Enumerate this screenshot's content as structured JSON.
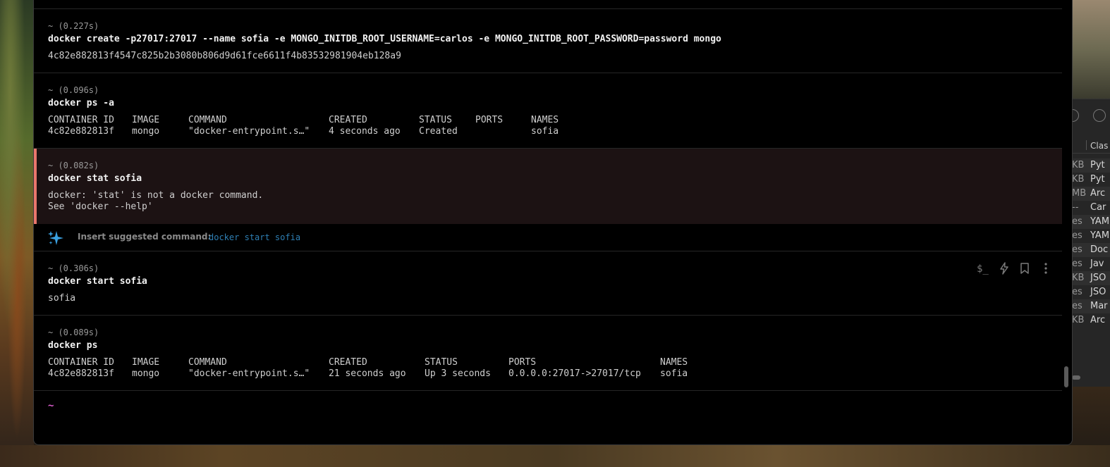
{
  "terminal": {
    "blocks": [
      {
        "id": "b1",
        "meta": "~ (0.227s)",
        "command": "docker create -p27017:27017 --name sofia -e MONGO_INITDB_ROOT_USERNAME=carlos -e MONGO_INITDB_ROOT_PASSWORD=password mongo",
        "output": "4c82e882813f4547c825b2b3080b806d9d61fce6611f4b83532981904eb128a9"
      },
      {
        "id": "b2",
        "meta": "~ (0.096s)",
        "command": "docker ps -a",
        "table": {
          "headers": [
            "CONTAINER ID",
            "IMAGE",
            "COMMAND",
            "CREATED",
            "STATUS",
            "PORTS",
            "NAMES"
          ],
          "row": [
            "4c82e882813f",
            "mongo",
            "\"docker-entrypoint.s…\"",
            "4 seconds ago",
            "Created",
            "",
            "sofia"
          ]
        }
      },
      {
        "id": "b3",
        "meta": "~ (0.082s)",
        "command": "docker stat sofia",
        "output_lines": [
          "docker: 'stat' is not a docker command.",
          "See 'docker --help'"
        ],
        "status": "error"
      },
      {
        "id": "b4",
        "meta": "~ (0.306s)",
        "command": "docker start sofia",
        "output": "sofia"
      },
      {
        "id": "b5",
        "meta": "~ (0.089s)",
        "command": "docker ps",
        "table": {
          "headers": [
            "CONTAINER ID",
            "IMAGE",
            "COMMAND",
            "CREATED",
            "STATUS",
            "PORTS",
            "NAMES"
          ],
          "row": [
            "4c82e882813f",
            "mongo",
            "\"docker-entrypoint.s…\"",
            "21 seconds ago",
            "Up 3 seconds",
            "0.0.0.0:27017->27017/tcp",
            "sofia"
          ]
        }
      }
    ],
    "suggestion": {
      "label": "Insert suggested command:",
      "command": "docker start sofia"
    },
    "block_actions": [
      "dollar-prompt-icon",
      "lightning-icon",
      "bookmark-icon",
      "more-vertical-icon"
    ],
    "prompt": "~",
    "colors": {
      "error_accent": "#e9766c",
      "suggestion_link": "#2e7fb4",
      "prompt": "#e05fd1"
    }
  },
  "background_app": {
    "column_header": "Clas",
    "rows": [
      {
        "size": "KB",
        "kind": "Pyt"
      },
      {
        "size": "KB",
        "kind": "Pyt"
      },
      {
        "size": "MB",
        "kind": "Arc"
      },
      {
        "size": "--",
        "kind": "Car"
      },
      {
        "size": "es",
        "kind": "YAM"
      },
      {
        "size": "es",
        "kind": "YAM"
      },
      {
        "size": "es",
        "kind": "Doc"
      },
      {
        "size": "es",
        "kind": "Jav"
      },
      {
        "size": "KB",
        "kind": "JSO"
      },
      {
        "size": "es",
        "kind": "JSO"
      },
      {
        "size": "es",
        "kind": "Mar"
      },
      {
        "size": "KB",
        "kind": "Arc"
      }
    ]
  }
}
